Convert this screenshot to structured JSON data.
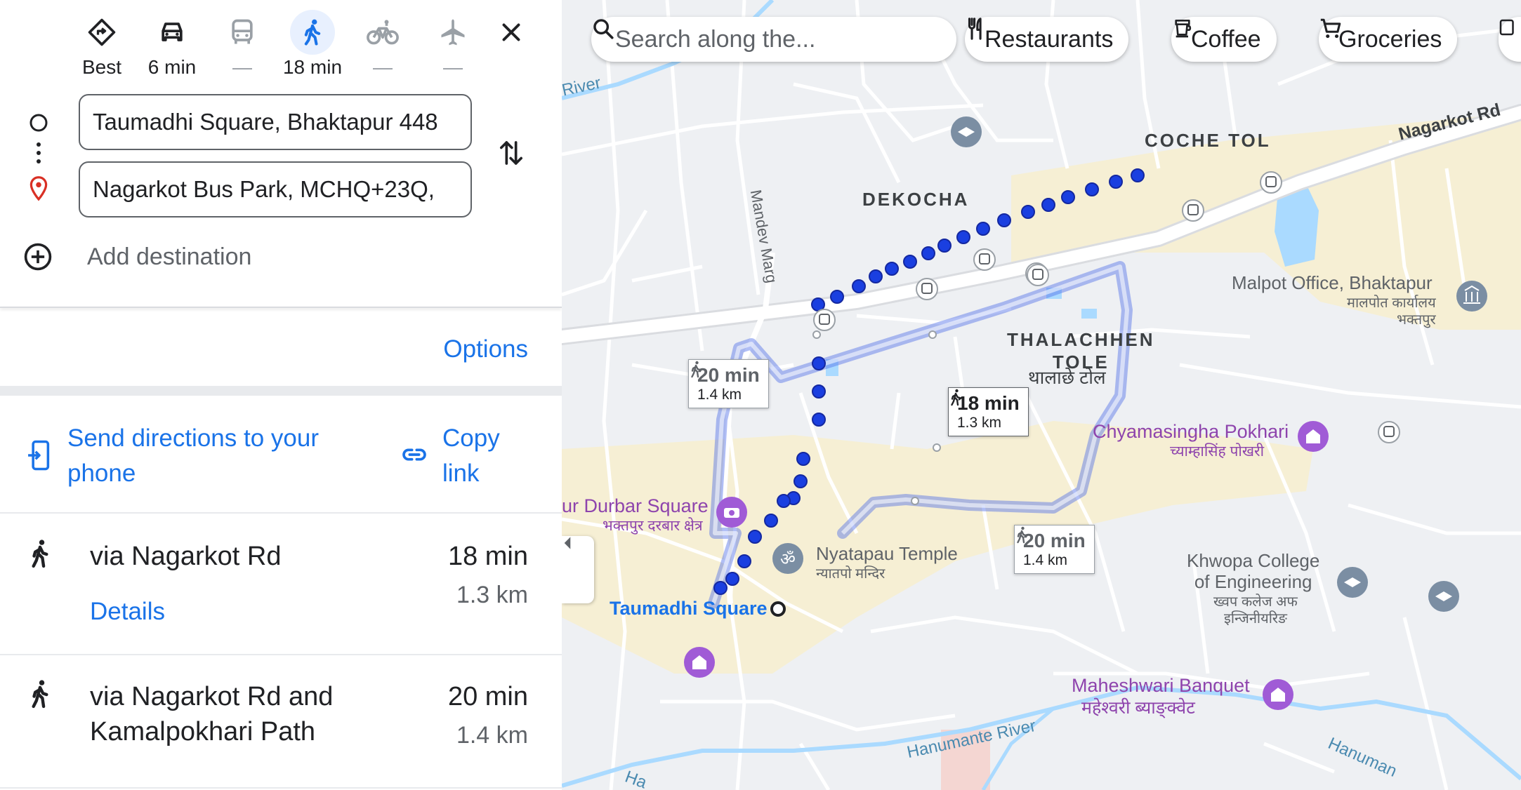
{
  "travel_modes": [
    {
      "name": "best",
      "label": "Best",
      "icon": "directions-icon"
    },
    {
      "name": "driving",
      "label": "6 min",
      "icon": "car-icon"
    },
    {
      "name": "transit",
      "label": "—",
      "icon": "bus-icon"
    },
    {
      "name": "walking",
      "label": "18 min",
      "icon": "walk-icon",
      "selected": true
    },
    {
      "name": "cycling",
      "label": "—",
      "icon": "bicycle-icon"
    },
    {
      "name": "flights",
      "label": "—",
      "icon": "airplane-icon"
    }
  ],
  "directions": {
    "origin": "Taumadhi Square, Bhaktapur 448",
    "destination": "Nagarkot Bus Park, MCHQ+23Q,",
    "add_destination": "Add destination",
    "options": "Options",
    "send_to_phone": "Send directions to your phone",
    "copy_link": "Copy link"
  },
  "routes": [
    {
      "via": "via Nagarkot Rd",
      "time": "18 min",
      "distance": "1.3 km",
      "details": "Details"
    },
    {
      "via": "via Nagarkot Rd and Kamalpokhari Path",
      "time": "20 min",
      "distance": "1.4 km"
    }
  ],
  "map": {
    "search_placeholder": "Search along the...",
    "chips": [
      "Restaurants",
      "Coffee",
      "Groceries"
    ],
    "route_callouts": [
      {
        "time": "20 min",
        "distance": "1.4 km"
      },
      {
        "time": "18 min",
        "distance": "1.3 km"
      },
      {
        "time": "20 min",
        "distance": "1.4 km"
      }
    ],
    "areas": {
      "coche_tol": "COCHE TOL",
      "dekocha": "DEKOCHA",
      "thalachhen": "THALACHHEN\nTOLE",
      "thalachhen_dev": "थालाछे टोल"
    },
    "places": {
      "malpot": "Malpot Office, Bhaktapur",
      "malpot_dev": "मालपोत कार्यालय\nभक्तपुर",
      "chyamasingha": "Chyamasingha Pokhari",
      "chyamasingha_dev": "च्याम्हासिंह पोखरी",
      "durbar": "ur Durbar Square",
      "durbar_dev": "भक्तपुर दरबार क्षेत्र",
      "nyatapau": "Nyatapau Temple",
      "nyatapau_dev": "न्यातपो मन्दिर",
      "taumadhi": "Taumadhi Square",
      "khwopa": "Khwopa College\nof Engineering",
      "khwopa_dev": "ख्वप कलेज अफ\nइन्जिनीयरिङ",
      "maheshwari": "Maheshwari Banquet",
      "maheshwari_dev": "महेश्वरी ब्याङ्क्वेट"
    },
    "roads": {
      "nagarkot_rd": "Nagarkot Rd",
      "mandev_marg": "Mandev Marg",
      "river_top": "River",
      "hanumante_river": "Hanumante River",
      "hanuman_right": "Hanuman",
      "ha_left": "Ha"
    }
  }
}
